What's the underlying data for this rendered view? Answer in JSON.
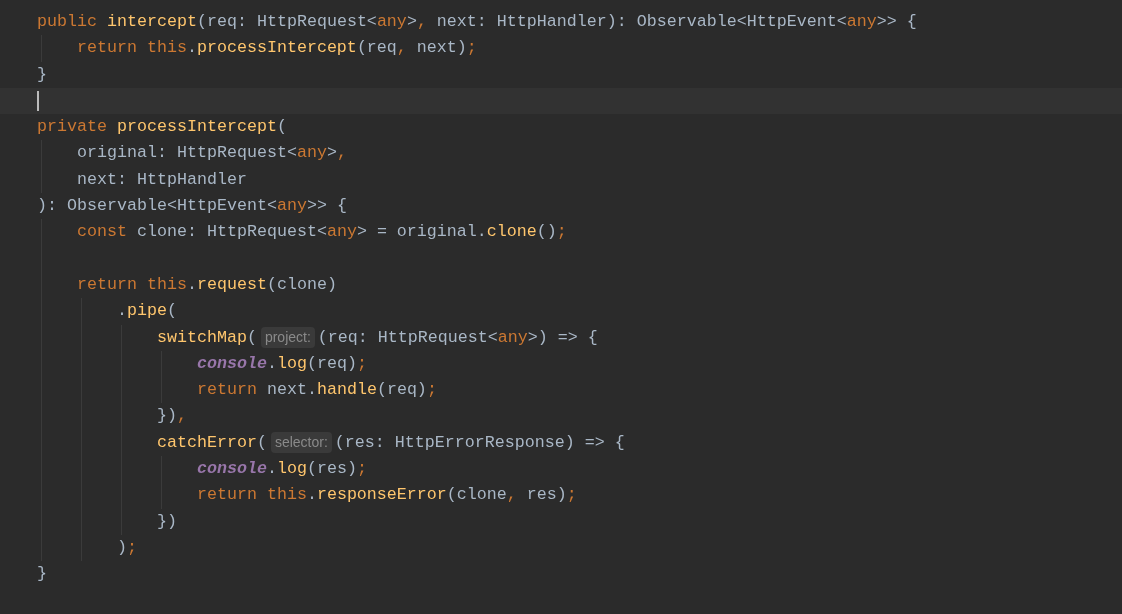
{
  "editor": {
    "lines": [
      {
        "current": false,
        "tokens": [
          {
            "kind": "keyword",
            "text": "public"
          },
          {
            "kind": "function",
            "text": " intercept"
          },
          {
            "kind": "plain",
            "text": "(req: HttpRequest<"
          },
          {
            "kind": "keyword",
            "text": "any"
          },
          {
            "kind": "plain",
            "text": ">"
          },
          {
            "kind": "keyword",
            "text": ","
          },
          {
            "kind": "plain",
            "text": " next: HttpHandler): Observable<HttpEvent<"
          },
          {
            "kind": "keyword",
            "text": "any"
          },
          {
            "kind": "plain",
            "text": ">> {"
          }
        ]
      },
      {
        "current": false,
        "tokens": [
          {
            "kind": "keyword",
            "text": "    return this"
          },
          {
            "kind": "plain",
            "text": "."
          },
          {
            "kind": "function",
            "text": "processIntercept"
          },
          {
            "kind": "plain",
            "text": "(req"
          },
          {
            "kind": "keyword",
            "text": ","
          },
          {
            "kind": "plain",
            "text": " next)"
          },
          {
            "kind": "keyword",
            "text": ";"
          }
        ]
      },
      {
        "current": false,
        "tokens": [
          {
            "kind": "plain",
            "text": "}"
          }
        ]
      },
      {
        "current": true
      },
      {
        "current": false,
        "tokens": [
          {
            "kind": "keyword",
            "text": "private"
          },
          {
            "kind": "function",
            "text": " processIntercept"
          },
          {
            "kind": "plain",
            "text": "("
          }
        ]
      },
      {
        "current": false,
        "tokens": [
          {
            "kind": "plain",
            "text": "    original: HttpRequest<"
          },
          {
            "kind": "keyword",
            "text": "any"
          },
          {
            "kind": "plain",
            "text": ">"
          },
          {
            "kind": "keyword",
            "text": ","
          }
        ]
      },
      {
        "current": false,
        "tokens": [
          {
            "kind": "plain",
            "text": "    next: HttpHandler"
          }
        ]
      },
      {
        "current": false,
        "tokens": [
          {
            "kind": "plain",
            "text": "): Observable<HttpEvent<"
          },
          {
            "kind": "keyword",
            "text": "any"
          },
          {
            "kind": "plain",
            "text": ">> {"
          }
        ]
      },
      {
        "current": false,
        "tokens": [
          {
            "kind": "keyword",
            "text": "    const"
          },
          {
            "kind": "plain",
            "text": " clone: HttpRequest<"
          },
          {
            "kind": "keyword",
            "text": "any"
          },
          {
            "kind": "plain",
            "text": "> = original."
          },
          {
            "kind": "function",
            "text": "clone"
          },
          {
            "kind": "plain",
            "text": "()"
          },
          {
            "kind": "keyword",
            "text": ";"
          }
        ]
      },
      {
        "current": false
      },
      {
        "current": false,
        "tokens": [
          {
            "kind": "keyword",
            "text": "    return this"
          },
          {
            "kind": "plain",
            "text": "."
          },
          {
            "kind": "function",
            "text": "request"
          },
          {
            "kind": "plain",
            "text": "(clone)"
          }
        ]
      },
      {
        "current": false,
        "tokens": [
          {
            "kind": "plain",
            "text": "        ."
          },
          {
            "kind": "function",
            "text": "pipe"
          },
          {
            "kind": "plain",
            "text": "("
          }
        ]
      },
      {
        "current": false,
        "tokens": [
          {
            "kind": "function",
            "text": "            switchMap"
          },
          {
            "kind": "plain",
            "text": "("
          },
          {
            "kind": "hint",
            "text": "project:"
          },
          {
            "kind": "plain",
            "text": "(req: HttpRequest<"
          },
          {
            "kind": "keyword",
            "text": "any"
          },
          {
            "kind": "plain",
            "text": ">) => {"
          }
        ]
      },
      {
        "current": false,
        "tokens": [
          {
            "kind": "global",
            "text": "                console"
          },
          {
            "kind": "plain",
            "text": "."
          },
          {
            "kind": "function",
            "text": "log"
          },
          {
            "kind": "plain",
            "text": "(req)"
          },
          {
            "kind": "keyword",
            "text": ";"
          }
        ]
      },
      {
        "current": false,
        "tokens": [
          {
            "kind": "keyword",
            "text": "                return"
          },
          {
            "kind": "plain",
            "text": " next."
          },
          {
            "kind": "function",
            "text": "handle"
          },
          {
            "kind": "plain",
            "text": "(req)"
          },
          {
            "kind": "keyword",
            "text": ";"
          }
        ]
      },
      {
        "current": false,
        "tokens": [
          {
            "kind": "plain",
            "text": "            })"
          },
          {
            "kind": "keyword",
            "text": ","
          }
        ]
      },
      {
        "current": false,
        "tokens": [
          {
            "kind": "function",
            "text": "            catchError"
          },
          {
            "kind": "plain",
            "text": "("
          },
          {
            "kind": "hint",
            "text": "selector:"
          },
          {
            "kind": "plain",
            "text": "(res: HttpErrorResponse) => {"
          }
        ]
      },
      {
        "current": false,
        "tokens": [
          {
            "kind": "global",
            "text": "                console"
          },
          {
            "kind": "plain",
            "text": "."
          },
          {
            "kind": "function",
            "text": "log"
          },
          {
            "kind": "plain",
            "text": "(res)"
          },
          {
            "kind": "keyword",
            "text": ";"
          }
        ]
      },
      {
        "current": false,
        "tokens": [
          {
            "kind": "keyword",
            "text": "                return this"
          },
          {
            "kind": "plain",
            "text": "."
          },
          {
            "kind": "function",
            "text": "responseError"
          },
          {
            "kind": "plain",
            "text": "(clone"
          },
          {
            "kind": "keyword",
            "text": ","
          },
          {
            "kind": "plain",
            "text": " res)"
          },
          {
            "kind": "keyword",
            "text": ";"
          }
        ]
      },
      {
        "current": false,
        "tokens": [
          {
            "kind": "plain",
            "text": "            })"
          }
        ]
      },
      {
        "current": false,
        "tokens": [
          {
            "kind": "plain",
            "text": "        )"
          },
          {
            "kind": "keyword",
            "text": ";"
          }
        ]
      },
      {
        "current": false,
        "tokens": [
          {
            "kind": "plain",
            "text": "}"
          }
        ]
      }
    ]
  }
}
